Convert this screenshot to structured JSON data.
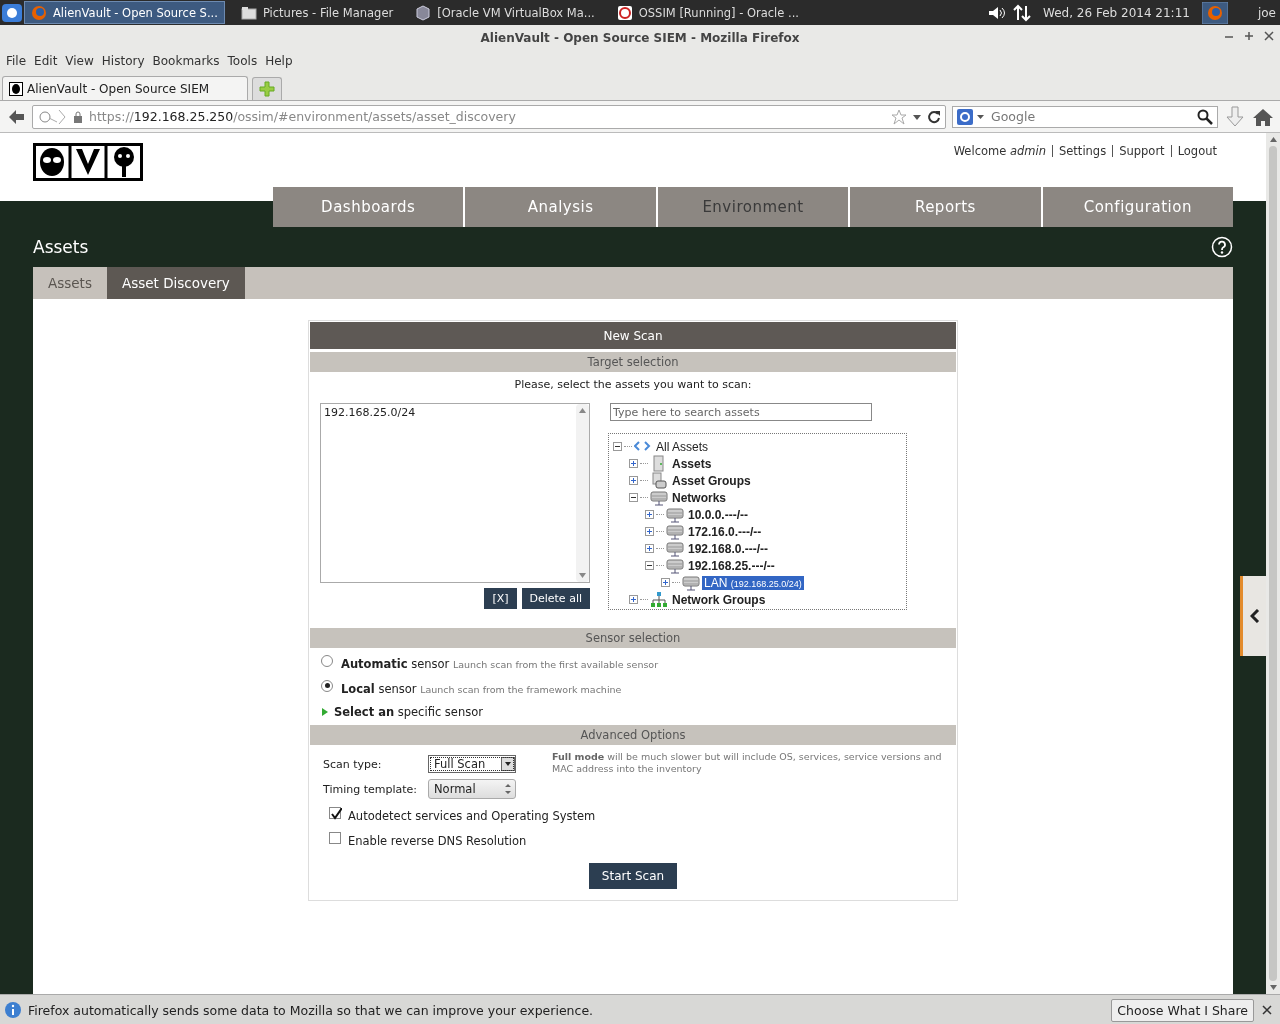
{
  "taskbar": {
    "tasks": [
      {
        "label": "AlienVault - Open Source S...",
        "selected": true
      },
      {
        "label": "Pictures - File Manager",
        "selected": false
      },
      {
        "label": "[Oracle VM VirtualBox Ma...",
        "selected": false
      },
      {
        "label": "OSSIM [Running] - Oracle ...",
        "selected": false
      }
    ],
    "clock": "Wed, 26 Feb 2014 21:11",
    "user": "joe"
  },
  "window": {
    "title": "AlienVault - Open Source SIEM - Mozilla Firefox"
  },
  "menu": [
    "File",
    "Edit",
    "View",
    "History",
    "Bookmarks",
    "Tools",
    "Help"
  ],
  "tabs": [
    {
      "label": "AlienVault - Open Source SIEM",
      "selected": true
    }
  ],
  "url": {
    "scheme": "https://",
    "host": "192.168.25.250",
    "path": "/ossim/#environment/assets/asset_discovery"
  },
  "web_search": {
    "placeholder": "Google"
  },
  "header": {
    "welcome": "Welcome *admin*",
    "links": [
      "Settings",
      "Support",
      "Logout"
    ]
  },
  "nav": [
    {
      "label": "Dashboards",
      "selected": false
    },
    {
      "label": "Analysis",
      "selected": false
    },
    {
      "label": "Environment",
      "selected": true
    },
    {
      "label": "Reports",
      "selected": false
    },
    {
      "label": "Configuration",
      "selected": false
    }
  ],
  "page_title": "Assets",
  "subtabs": [
    {
      "label": "Assets",
      "selected": false
    },
    {
      "label": "Asset Discovery",
      "selected": true
    }
  ],
  "form": {
    "title": "New Scan",
    "target": {
      "heading": "Target selection",
      "prompt": "Please, select the assets you want to scan:",
      "selected_assets": [
        "192.168.25.0/24"
      ],
      "search_placeholder": "Type here to search assets",
      "buttons": [
        "[X]",
        "Delete all"
      ],
      "tree": [
        {
          "label": "All Assets",
          "kind": "root",
          "expanded": true,
          "selected": false,
          "children": [
            {
              "label": "Assets",
              "kind": "host",
              "expanded": false,
              "selected": false
            },
            {
              "label": "Asset Groups",
              "kind": "hostgroup",
              "expanded": false,
              "selected": false
            },
            {
              "label": "Networks",
              "kind": "network",
              "expanded": true,
              "selected": false,
              "children": [
                {
                  "label": "10.0.0.---/--",
                  "kind": "network",
                  "expanded": false,
                  "selected": false
                },
                {
                  "label": "172.16.0.---/--",
                  "kind": "network",
                  "expanded": false,
                  "selected": false
                },
                {
                  "label": "192.168.0.---/--",
                  "kind": "network",
                  "expanded": false,
                  "selected": false
                },
                {
                  "label": "192.168.25.---/--",
                  "kind": "network",
                  "expanded": true,
                  "selected": false,
                  "children": [
                    {
                      "label": "LAN",
                      "sublabel": "(192.168.25.0/24)",
                      "kind": "cidr",
                      "expanded": false,
                      "selected": true
                    }
                  ]
                }
              ]
            },
            {
              "label": "Network Groups",
              "kind": "netgroup",
              "expanded": false,
              "selected": false
            }
          ]
        }
      ]
    },
    "sensor": {
      "heading": "Sensor selection",
      "options": [
        {
          "label": "**Automatic** sensor",
          "hint": "Launch scan from the first available sensor",
          "selected": false
        },
        {
          "label": "**Local** sensor",
          "hint": "Launch scan from the framework machine",
          "selected": true
        }
      ],
      "specific": "**Select an** specific sensor"
    },
    "advanced": {
      "heading": "Advanced Options",
      "scan_type": {
        "label": "Scan type:",
        "value": "Full Scan"
      },
      "note": "**Full mode** will be much slower but will include OS, services, service versions and MAC address into the inventory",
      "timing": {
        "label": "Timing template:",
        "value": "Normal"
      },
      "checks": [
        {
          "label": "Autodetect services and Operating System",
          "checked": true
        },
        {
          "label": "Enable reverse DNS Resolution",
          "checked": false
        }
      ],
      "submit": "Start Scan"
    }
  },
  "notification": {
    "text": "Firefox automatically sends some data to Mozilla so that we can improve your experience.",
    "button": "Choose What I Share"
  }
}
